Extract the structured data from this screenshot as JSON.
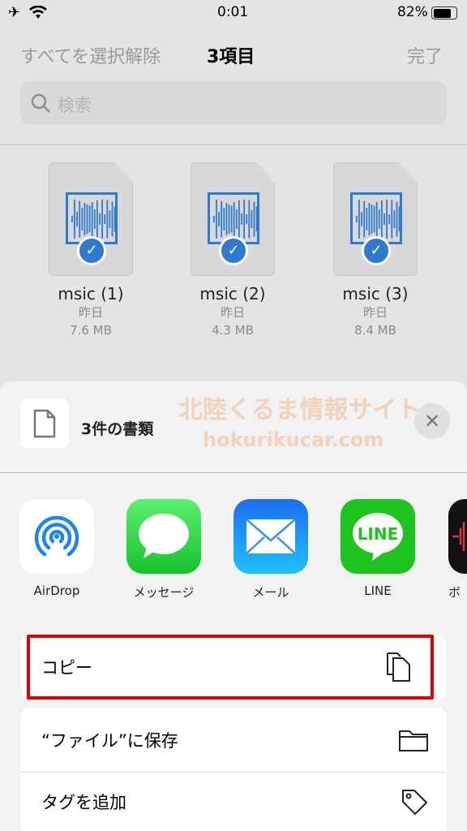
{
  "status": {
    "time": "0:01",
    "battery": "82%",
    "icons": [
      "airplane-icon",
      "wifi-icon",
      "battery-icon"
    ]
  },
  "nav": {
    "deselect_all": "すべてを選択解除",
    "title": "3項目",
    "done": "完了"
  },
  "search": {
    "placeholder": "検索"
  },
  "files": [
    {
      "name": "msic (1)",
      "date": "昨日",
      "size": "7.6 MB"
    },
    {
      "name": "msic (2)",
      "date": "昨日",
      "size": "4.3 MB"
    },
    {
      "name": "msic (3)",
      "date": "昨日",
      "size": "8.4 MB"
    }
  ],
  "sheet": {
    "title": "3件の書類",
    "apps": [
      {
        "label": "AirDrop"
      },
      {
        "label": "メッセージ"
      },
      {
        "label": "メール"
      },
      {
        "label": "LINE",
        "logo_text": "LINE"
      },
      {
        "label": "ボ"
      }
    ],
    "actions": [
      {
        "label": "コピー",
        "icon": "copy-icon",
        "highlighted": true
      },
      {
        "label": "“ファイル”に保存",
        "icon": "folder-icon"
      },
      {
        "label": "タグを追加",
        "icon": "tag-icon"
      }
    ]
  },
  "watermark": {
    "text": "北陸くるま情報サイト",
    "url": "hokurikucar.com"
  },
  "colors": {
    "accent": "#2e7ad1",
    "highlight": "#e00000",
    "line_green": "#1ec31e"
  }
}
